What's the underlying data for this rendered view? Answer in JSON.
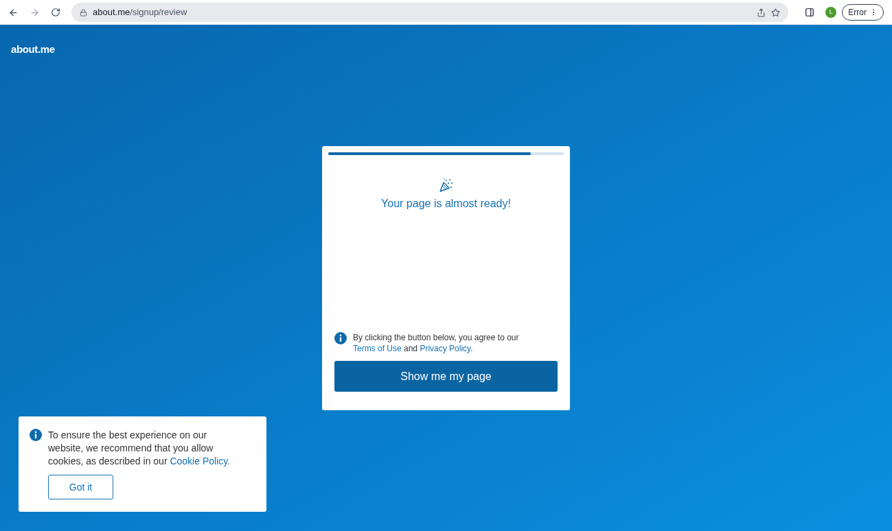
{
  "browser": {
    "url_host": "about.me",
    "url_path": "/signup/review",
    "profile_initial": "L",
    "status_button": "Error"
  },
  "site": {
    "logo": "about.me"
  },
  "card": {
    "progress": {
      "level": 0.86
    },
    "title": "Your page is almost ready!",
    "consent": {
      "before": "By clicking the button below, you agree to our ",
      "terms_link": "Terms of Use",
      "middle": " and ",
      "privacy_link": "Privacy Policy."
    },
    "button": "Show me my page"
  },
  "cookie_notice": {
    "text": "To ensure the best experience on our website, we recommend that you allow cookies, as described in our ",
    "link": "Cookie Policy.",
    "button": "Got it"
  }
}
